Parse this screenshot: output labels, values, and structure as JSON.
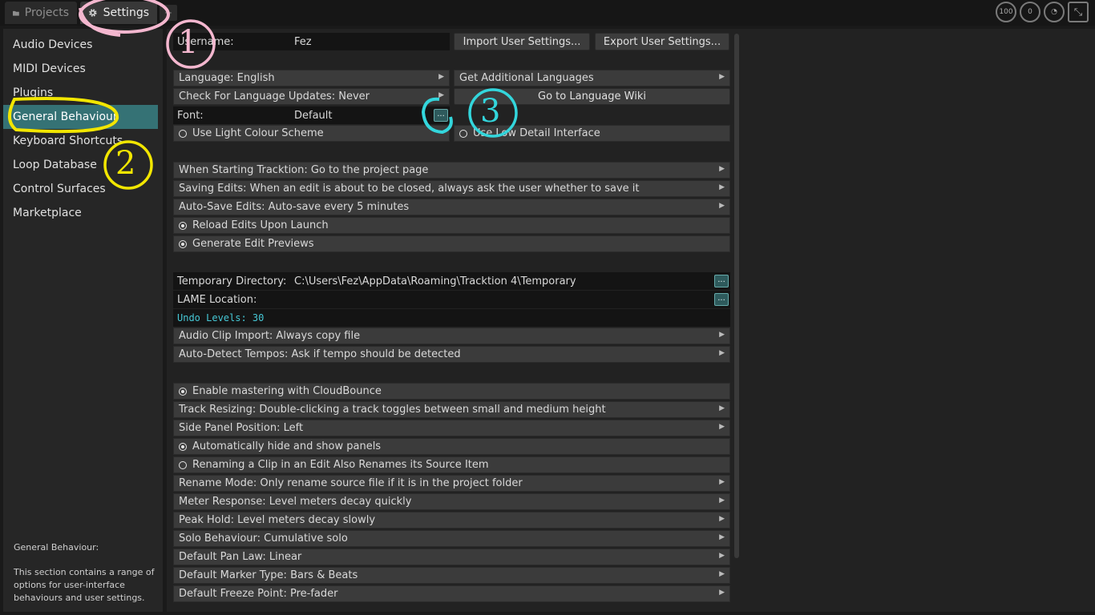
{
  "tabs": {
    "projects": "Projects",
    "settings": "Settings",
    "add": "+"
  },
  "top_icons": {
    "cpu": "100",
    "meter": "0",
    "clock": "clock-icon",
    "expand": "expand-icon"
  },
  "sidebar": {
    "items": [
      "Audio Devices",
      "MIDI Devices",
      "Plugins",
      "General Behaviour",
      "Keyboard Shortcuts",
      "Loop Database",
      "Control Surfaces",
      "Marketplace"
    ],
    "description_title": "General Behaviour:",
    "description": "This section contains a range of options for user-interface behaviours and user settings."
  },
  "settings": {
    "username_label": "Username:",
    "username_value": "Fez",
    "import_button": "Import User Settings...",
    "export_button": "Export User Settings...",
    "language": "Language: English",
    "get_languages": "Get Additional Languages",
    "check_updates": "Check For Language Updates: Never",
    "language_wiki": "Go to Language Wiki",
    "font_label": "Font:",
    "font_value": "Default",
    "dots": "...",
    "light_scheme": "Use Light Colour Scheme",
    "low_detail": "Use Low Detail Interface",
    "starting": "When Starting Tracktion: Go to the project page",
    "saving": "Saving Edits: When an edit is about to be closed, always ask the user whether to save it",
    "autosave": "Auto-Save Edits: Auto-save every 5 minutes",
    "reload": "Reload Edits Upon Launch",
    "previews": "Generate Edit Previews",
    "tempdir_label": "Temporary Directory:",
    "tempdir_value": "C:\\Users\\Fez\\AppData\\Roaming\\Tracktion 4\\Temporary",
    "lame_label": "LAME Location:",
    "undo": "Undo Levels: 30",
    "clip_import": "Audio Clip Import: Always copy file",
    "tempos": "Auto-Detect Tempos: Ask if tempo should be detected",
    "mastering": "Enable mastering with CloudBounce",
    "resizing": "Track Resizing: Double-clicking a track toggles between small and medium height",
    "side_panel": "Side Panel Position: Left",
    "auto_hide": "Automatically hide and show panels",
    "renaming": "Renaming a Clip in an Edit Also Renames its Source Item",
    "rename_mode": "Rename Mode: Only rename source file if it is in the project folder",
    "meter_response": "Meter Response: Level meters decay quickly",
    "peak_hold": "Peak Hold: Level meters decay slowly",
    "solo": "Solo Behaviour: Cumulative solo",
    "pan_law": "Default Pan Law: Linear",
    "marker": "Default Marker Type: Bars & Beats",
    "freeze": "Default Freeze Point: Pre-fader"
  },
  "annotations": {
    "n1": "1",
    "n2": "2",
    "n3": "3"
  },
  "colors": {
    "accent": "#357275",
    "pink": "#f4b7cf",
    "yellow": "#f2e600",
    "cyan": "#33d6dc"
  }
}
